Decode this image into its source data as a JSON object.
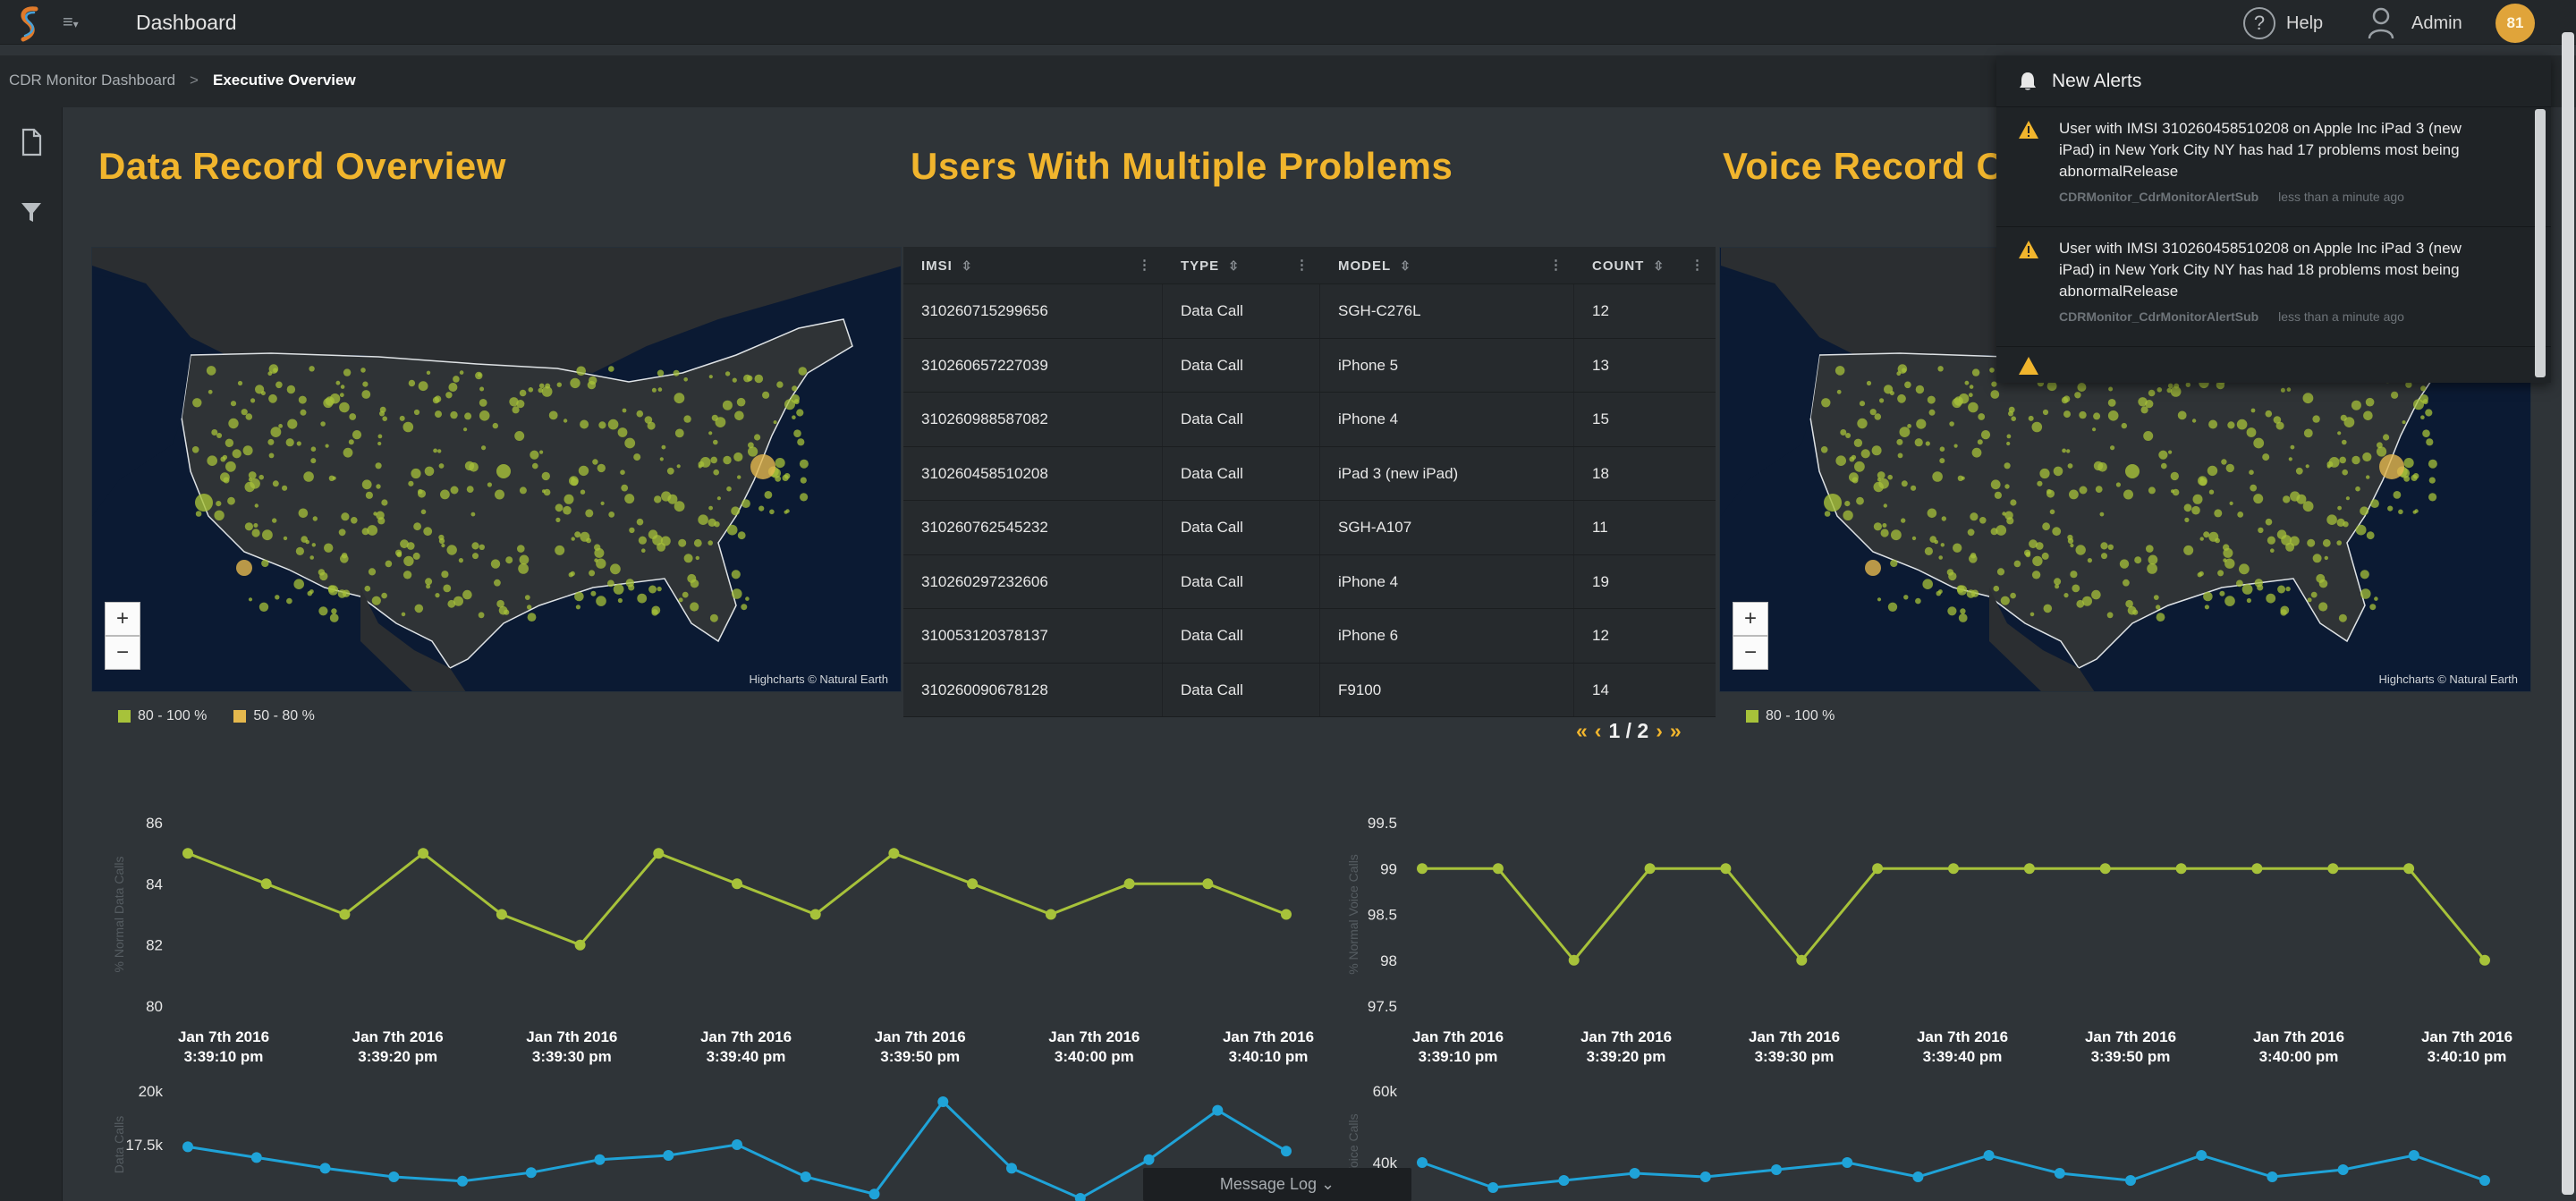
{
  "topbar": {
    "logo_icon": "app-logo-icon",
    "menu_icon": "hamburger-icon",
    "title": "Dashboard",
    "help_label": "Help",
    "admin_label": "Admin",
    "avatar_text": "81"
  },
  "breadcrumb": {
    "items": [
      "CDR Monitor Dashboard",
      "Executive Overview"
    ],
    "separator": ">"
  },
  "sidebar": {
    "icons": [
      "document-icon",
      "filter-icon"
    ]
  },
  "sections": {
    "data_record_title": "Data Record Overview",
    "users_title": "Users With Multiple Problems",
    "voice_record_title": "Voice Record C"
  },
  "maps": {
    "zoom_in": "+",
    "zoom_out": "−",
    "credits": "Highcharts © Natural Earth",
    "legend_left": [
      {
        "label": "80 - 100 %",
        "color": "#a7c23a"
      },
      {
        "label": "50 - 80 %",
        "color": "#e5b84d"
      }
    ],
    "legend_right": [
      {
        "label": "80 - 100 %",
        "color": "#a7c23a"
      }
    ]
  },
  "table": {
    "columns": [
      "IMSI",
      "TYPE",
      "MODEL",
      "COUNT"
    ],
    "rows": [
      [
        "310260715299656",
        "Data Call",
        "SGH-C276L",
        "12"
      ],
      [
        "310260657227039",
        "Data Call",
        "iPhone 5",
        "13"
      ],
      [
        "310260988587082",
        "Data Call",
        "iPhone 4",
        "15"
      ],
      [
        "310260458510208",
        "Data Call",
        "iPad 3 (new iPad)",
        "18"
      ],
      [
        "310260762545232",
        "Data Call",
        "SGH-A107",
        "11"
      ],
      [
        "310260297232606",
        "Data Call",
        "iPhone 4",
        "19"
      ],
      [
        "310053120378137",
        "Data Call",
        "iPhone 6",
        "12"
      ],
      [
        "310260090678128",
        "Data Call",
        "F9100",
        "14"
      ]
    ],
    "pager": {
      "first": "«",
      "prev": "‹",
      "page": "1 / 2",
      "next": "›",
      "last": "»"
    }
  },
  "alerts": {
    "title": "New Alerts",
    "items": [
      {
        "message": "User with IMSI 310260458510208 on Apple Inc iPad 3 (new iPad) in New York City NY has had 17 problems most being abnormalRelease",
        "source": "CDRMonitor_CdrMonitorAlertSub",
        "time": "less than a minute ago"
      },
      {
        "message": "User with IMSI 310260458510208 on Apple Inc iPad 3 (new iPad) in New York City NY has had 18 problems most being abnormalRelease",
        "source": "CDRMonitor_CdrMonitorAlertSub",
        "time": "less than a minute ago"
      }
    ]
  },
  "charts": {
    "x_labels": [
      [
        "Jan 7th 2016",
        "3:39:10 pm"
      ],
      [
        "Jan 7th 2016",
        "3:39:20 pm"
      ],
      [
        "Jan 7th 2016",
        "3:39:30 pm"
      ],
      [
        "Jan 7th 2016",
        "3:39:40 pm"
      ],
      [
        "Jan 7th 2016",
        "3:39:50 pm"
      ],
      [
        "Jan 7th 2016",
        "3:40:00 pm"
      ],
      [
        "Jan 7th 2016",
        "3:40:10 pm"
      ]
    ]
  },
  "chart_data": [
    {
      "type": "line",
      "ylabel": "% Normal Data Calls",
      "ylim": [
        80,
        86
      ],
      "yticks": [
        80,
        82,
        84,
        86
      ],
      "color": "#a7c23a",
      "values": [
        85,
        84,
        83,
        85,
        83,
        82,
        85,
        84,
        83,
        85,
        84,
        83,
        84,
        84,
        83
      ]
    },
    {
      "type": "line",
      "ylabel": "% Normal Voice Calls",
      "ylim": [
        97.5,
        99.5
      ],
      "yticks": [
        97.5,
        98,
        98.5,
        99,
        99.5
      ],
      "color": "#a7c23a",
      "values": [
        99,
        99,
        98,
        99,
        99,
        98,
        99,
        99,
        99,
        99,
        99,
        99,
        99,
        99,
        98
      ]
    },
    {
      "type": "line",
      "ylabel": "Data Calls",
      "yticks": [
        "17.5k",
        "20k"
      ],
      "ylim": [
        15000,
        20000
      ],
      "color": "#1fa3d8",
      "values": [
        17400,
        16900,
        16400,
        16000,
        15800,
        16200,
        16800,
        17000,
        17500,
        16000,
        15200,
        19500,
        16400,
        15000,
        16800,
        19100,
        17200
      ]
    },
    {
      "type": "line",
      "ylabel": "Voice Calls",
      "yticks": [
        "40k",
        "60k"
      ],
      "ylim": [
        30000,
        60000
      ],
      "color": "#1fa3d8",
      "values": [
        40000,
        33000,
        35000,
        37000,
        36000,
        38000,
        40000,
        36000,
        42000,
        37000,
        35000,
        42000,
        36000,
        38000,
        42000,
        35000
      ]
    }
  ],
  "message_log": {
    "label": "Message Log",
    "icon": "chevron-down-icon"
  }
}
